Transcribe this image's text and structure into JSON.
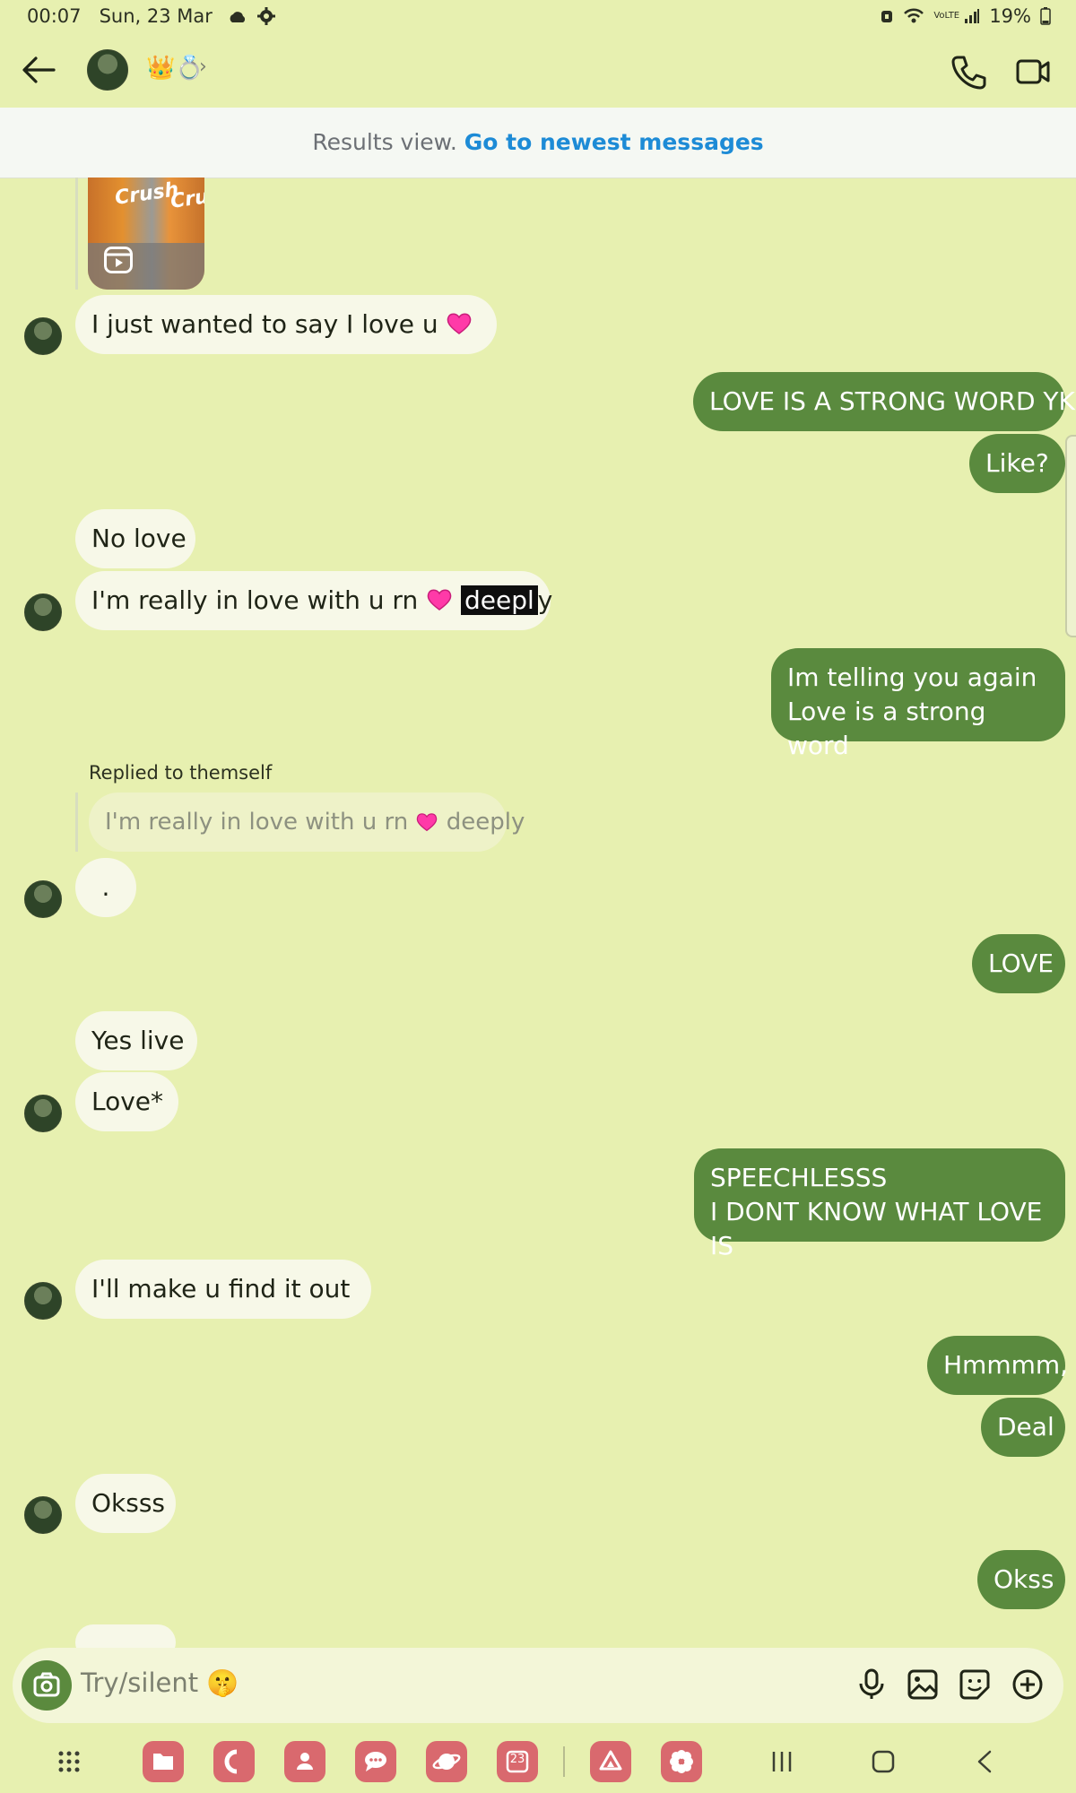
{
  "status_bar": {
    "time": "00:07",
    "date": "Sun, 23 Mar",
    "network": "VoLTE",
    "battery": "19%"
  },
  "header": {
    "contact_emoji": "👑💍"
  },
  "banner": {
    "muted_text": "Results view.",
    "link_text": "Go to newest messages"
  },
  "media": {
    "brand_text": "Crush"
  },
  "messages": [
    {
      "dir": "in",
      "text": "I just wanted to say I love u",
      "heart": true
    },
    {
      "dir": "out",
      "text": "LOVE IS A STRONG WORD YK"
    },
    {
      "dir": "out",
      "text": "Like?"
    },
    {
      "dir": "in",
      "text": "No love"
    },
    {
      "dir": "in",
      "text_before": "I'm really in love with u rn",
      "selected": "deepl",
      "text_after": "y"
    },
    {
      "dir": "out",
      "line1": "Im telling you again",
      "line2": "Love is a strong word"
    },
    {
      "dir": "in",
      "reply_label": "Replied to themself",
      "quoted": "I'm really in love with u rn",
      "quoted_after": "deeply",
      "text": "."
    },
    {
      "dir": "out",
      "text": "LOVE"
    },
    {
      "dir": "in",
      "text": "Yes live"
    },
    {
      "dir": "in",
      "text": "Love*"
    },
    {
      "dir": "out",
      "line1": "SPEECHLESSS",
      "line2": "I DONT KNOW WHAT LOVE IS"
    },
    {
      "dir": "in",
      "text": "I'll  make u find it out"
    },
    {
      "dir": "out",
      "text": "Hmmmm,"
    },
    {
      "dir": "out",
      "text": "Deal"
    },
    {
      "dir": "in",
      "text": "Oksss"
    },
    {
      "dir": "out",
      "text": "Okss"
    }
  ],
  "composer": {
    "placeholder": "Try/silent 🤫"
  },
  "navbar": {
    "calendar_day": "23"
  },
  "colors": {
    "background": "#e7f0b0",
    "outgoing_bubble": "#5a8a3e",
    "incoming_bubble": "#f7f8e8",
    "link": "#1d8bd6",
    "app_icon": "#d9696e"
  }
}
